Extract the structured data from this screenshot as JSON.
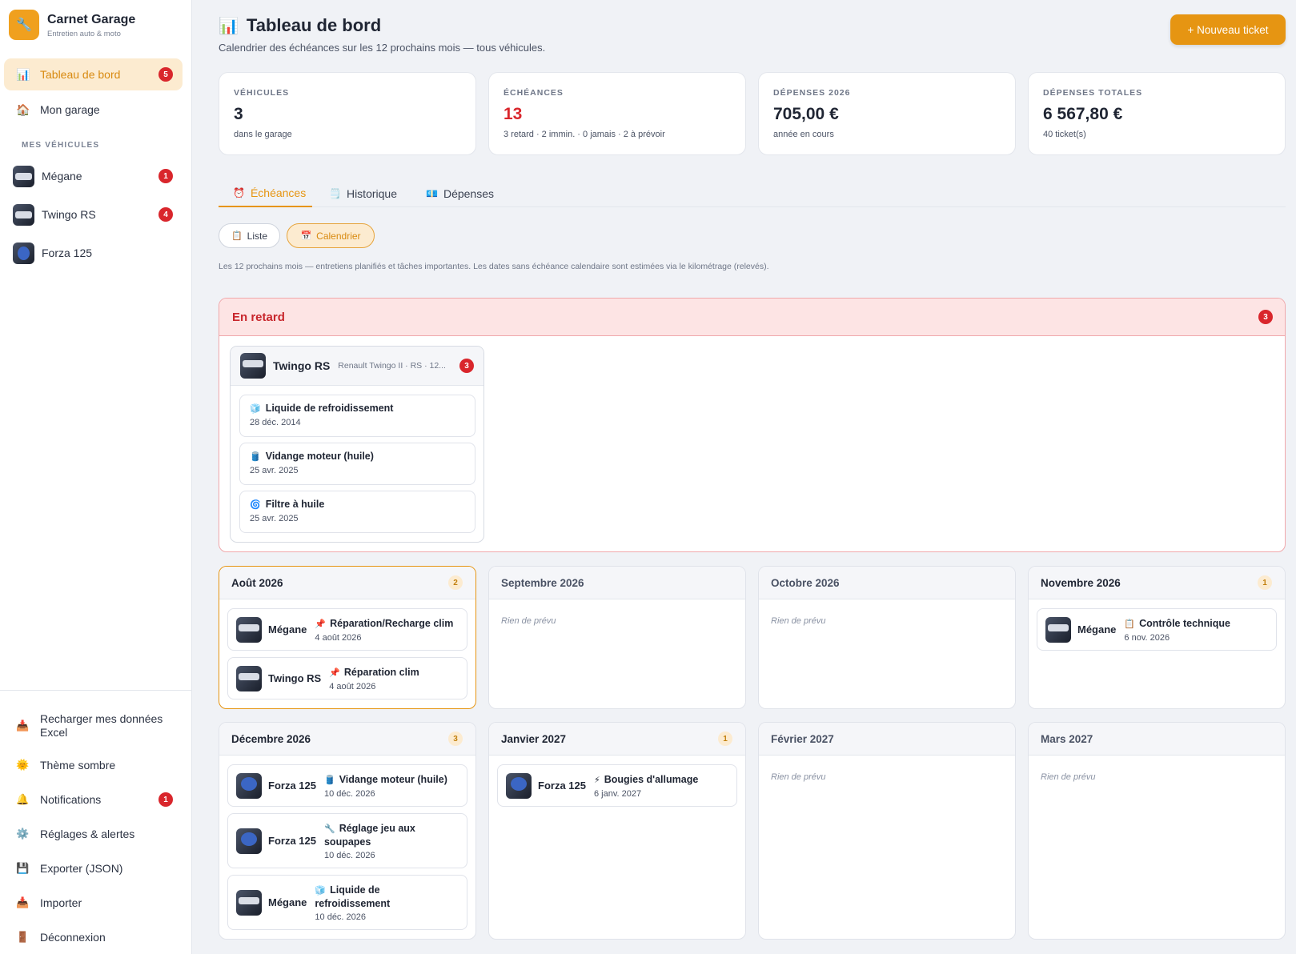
{
  "app": {
    "title": "Carnet Garage",
    "subtitle": "Entretien auto & moto",
    "logo_icon": "wrench-icon"
  },
  "sidebar": {
    "nav": [
      {
        "label": "Tableau de bord",
        "icon": "chart-icon",
        "badge": "5",
        "active": true
      },
      {
        "label": "Mon garage",
        "icon": "house-icon"
      }
    ],
    "section_label": "MES VÉHICULES",
    "vehicles": [
      {
        "name": "Mégane",
        "badge": "1"
      },
      {
        "name": "Twingo RS",
        "badge": "4"
      },
      {
        "name": "Forza 125"
      }
    ],
    "bottom": [
      {
        "label": "Recharger mes données Excel",
        "icon": "inbox-tray-icon"
      },
      {
        "label": "Thème sombre",
        "icon": "sun-icon"
      },
      {
        "label": "Notifications",
        "icon": "bell-icon",
        "badge": "1"
      },
      {
        "label": "Réglages & alertes",
        "icon": "gear-icon"
      },
      {
        "label": "Exporter (JSON)",
        "icon": "floppy-icon"
      },
      {
        "label": "Importer",
        "icon": "inbox-tray-icon"
      },
      {
        "label": "Déconnexion",
        "icon": "door-icon"
      }
    ]
  },
  "header": {
    "title": "Tableau de bord",
    "subtitle": "Calendrier des échéances sur les 12 prochains mois — tous véhicules.",
    "new_button": "+ Nouveau ticket"
  },
  "stats": [
    {
      "label": "VÉHICULES",
      "value": "3",
      "sub": "dans le garage"
    },
    {
      "label": "ÉCHÉANCES",
      "value": "13",
      "sub": "3 retard · 2 immin. · 0 jamais · 2 à prévoir",
      "color": "#d9262c"
    },
    {
      "label": "DÉPENSES 2026",
      "value": "705,00 €",
      "sub": "année en cours"
    },
    {
      "label": "DÉPENSES TOTALES",
      "value": "6 567,80 €",
      "sub": "40 ticket(s)"
    }
  ],
  "tabs": [
    {
      "label": "Échéances",
      "icon": "alarm-clock-icon",
      "active": true
    },
    {
      "label": "Historique",
      "icon": "notepad-icon"
    },
    {
      "label": "Dépenses",
      "icon": "money-icon"
    }
  ],
  "views": [
    {
      "label": "Liste",
      "icon": "clipboard-icon"
    },
    {
      "label": "Calendrier",
      "icon": "calendar-icon",
      "active": true
    }
  ],
  "note": "Les 12 prochains mois — entretiens planifiés et tâches importantes. Les dates sans échéance calendaire sont estimées via le kilométrage (relevés).",
  "late": {
    "title": "En retard",
    "count": "3",
    "vehicle": {
      "name": "Twingo RS",
      "model": "Renault Twingo II · RS · 12...",
      "count": "3"
    },
    "tasks": [
      {
        "title": "Liquide de refroidissement",
        "date": "28 déc. 2014",
        "icon": "ice-cube-icon"
      },
      {
        "title": "Vidange moteur (huile)",
        "date": "25 avr. 2025",
        "icon": "oil-drum-icon"
      },
      {
        "title": "Filtre à huile",
        "date": "25 avr. 2025",
        "icon": "spiral-icon"
      }
    ]
  },
  "months": [
    {
      "name": "Août 2026",
      "count": "2",
      "events": [
        {
          "vehicle": "Mégane",
          "title": "Réparation/Recharge clim",
          "date": "4 août 2026",
          "icon": "pushpin-icon"
        },
        {
          "vehicle": "Twingo RS",
          "title": "Réparation clim",
          "date": "4 août 2026",
          "icon": "pushpin-icon"
        }
      ]
    },
    {
      "name": "Septembre 2026",
      "empty": "Rien de prévu"
    },
    {
      "name": "Octobre 2026",
      "empty": "Rien de prévu"
    },
    {
      "name": "Novembre 2026",
      "count": "1",
      "events": [
        {
          "vehicle": "Mégane",
          "title": "Contrôle technique",
          "date": "6 nov. 2026",
          "icon": "clipboard-icon"
        }
      ]
    },
    {
      "name": "Décembre 2026",
      "count": "3",
      "events": [
        {
          "vehicle": "Forza 125",
          "title": "Vidange moteur (huile)",
          "date": "10 déc. 2026",
          "icon": "oil-drum-icon"
        },
        {
          "vehicle": "Forza 125",
          "title": "Réglage jeu aux soupapes",
          "date": "10 déc. 2026",
          "icon": "wrench-icon"
        },
        {
          "vehicle": "Mégane",
          "title": "Liquide de refroidissement",
          "date": "10 déc. 2026",
          "icon": "ice-cube-icon"
        }
      ]
    },
    {
      "name": "Janvier 2027",
      "count": "1",
      "events": [
        {
          "vehicle": "Forza 125",
          "title": "Bougies d'allumage",
          "date": "6 janv. 2027",
          "icon": "lightning-icon"
        }
      ]
    },
    {
      "name": "Février 2027",
      "empty": "Rien de prévu"
    },
    {
      "name": "Mars 2027",
      "empty": "Rien de prévu"
    }
  ]
}
